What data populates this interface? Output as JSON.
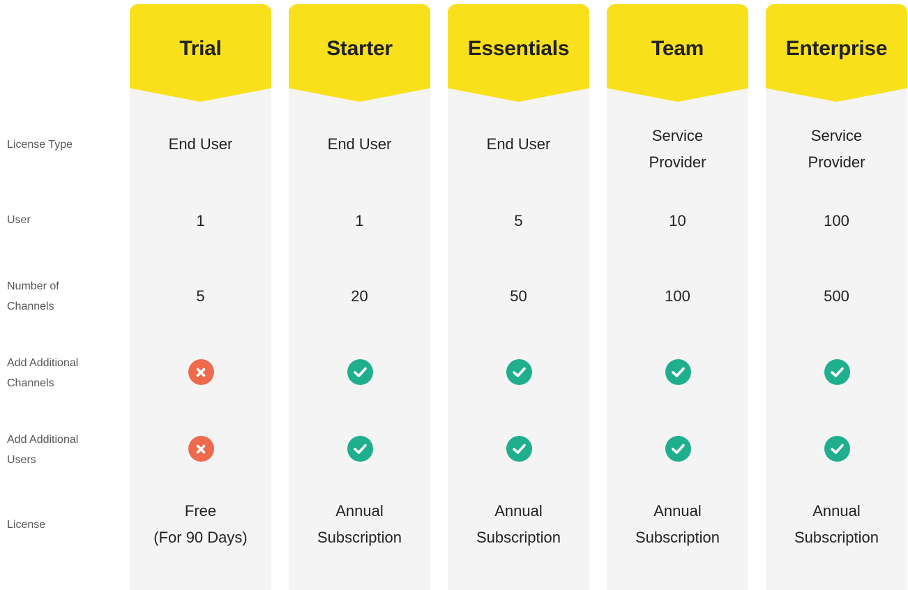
{
  "row_labels": {
    "license_type": "License Type",
    "user": "User",
    "channels": "Number of\nChannels",
    "add_channels": "Add Additional\nChannels",
    "add_users": "Add Additional\nUsers",
    "license": "License"
  },
  "colors": {
    "header": "#f8e01b",
    "column": "#f4f4f4",
    "check": "#1fae8e",
    "cross": "#ee6a4d"
  },
  "plans": [
    {
      "name": "Trial",
      "license_type": "End User",
      "user": "1",
      "channels": "5",
      "add_channels": "cross-icon",
      "add_users": "cross-icon",
      "license": "Free\n(For 90 Days)"
    },
    {
      "name": "Starter",
      "license_type": "End User",
      "user": "1",
      "channels": "20",
      "add_channels": "check-icon",
      "add_users": "check-icon",
      "license": "Annual\nSubscription"
    },
    {
      "name": "Essentials",
      "license_type": "End User",
      "user": "5",
      "channels": "50",
      "add_channels": "check-icon",
      "add_users": "check-icon",
      "license": "Annual\nSubscription"
    },
    {
      "name": "Team",
      "license_type": "Service\nProvider",
      "user": "10",
      "channels": "100",
      "add_channels": "check-icon",
      "add_users": "check-icon",
      "license": "Annual\nSubscription"
    },
    {
      "name": "Enterprise",
      "license_type": "Service\nProvider",
      "user": "100",
      "channels": "500",
      "add_channels": "check-icon",
      "add_users": "check-icon",
      "license": "Annual\nSubscription"
    }
  ]
}
